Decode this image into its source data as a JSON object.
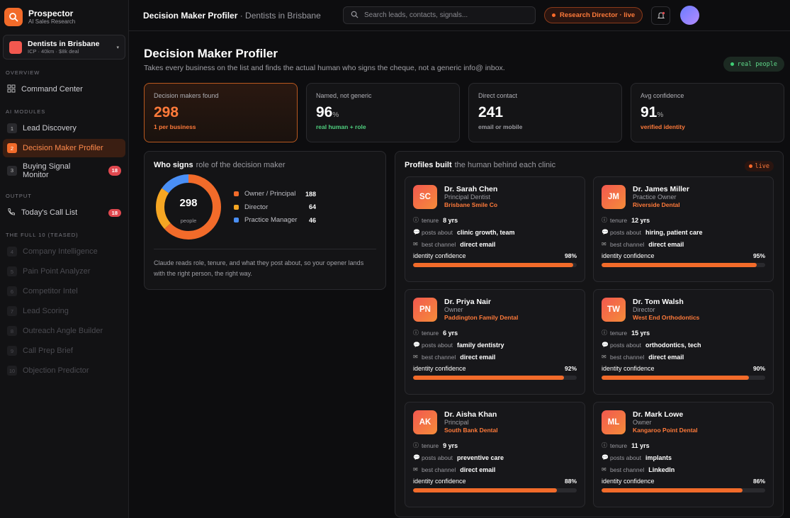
{
  "sidebar": {
    "brand": {
      "name": "Prospector",
      "sub": "AI Sales Research"
    },
    "icp": {
      "title": "Dentists in Brisbane",
      "sub": "ICP · 40km · $8k deal"
    },
    "sections": {
      "overview": "OVERVIEW",
      "modules": "AI MODULES",
      "output": "OUTPUT",
      "full10": "THE FULL 10 (TEASED)"
    },
    "command_center": "Command Center",
    "modules": [
      {
        "num": "1",
        "label": "Lead Discovery"
      },
      {
        "num": "2",
        "label": "Decision Maker Profiler"
      },
      {
        "num": "3",
        "label": "Buying Signal Monitor",
        "badge": "18"
      }
    ],
    "output": {
      "label": "Today's Call List",
      "badge": "18"
    },
    "teased": [
      {
        "num": "4",
        "label": "Company Intelligence"
      },
      {
        "num": "5",
        "label": "Pain Point Analyzer"
      },
      {
        "num": "6",
        "label": "Competitor Intel"
      },
      {
        "num": "7",
        "label": "Lead Scoring"
      },
      {
        "num": "8",
        "label": "Outreach Angle Builder"
      },
      {
        "num": "9",
        "label": "Call Prep Brief"
      },
      {
        "num": "10",
        "label": "Objection Predictor"
      }
    ]
  },
  "topbar": {
    "title": "Decision Maker Profiler",
    "context": " · Dentists in Brisbane",
    "search_placeholder": "Search leads, contacts, signals...",
    "live_pill": "Research Director · live"
  },
  "page": {
    "title": "Decision Maker Profiler",
    "subtitle": "Takes every business on the list and finds the actual human who signs the cheque, not a generic info@ inbox.",
    "tag": "real people"
  },
  "stats": [
    {
      "label": "Decision makers found",
      "value": "298",
      "unit": "",
      "foot": "1 per business",
      "foot_color": "#ff7a3a"
    },
    {
      "label": "Named, not generic",
      "value": "96",
      "unit": "%",
      "foot": "real human + role",
      "foot_color": "#4fd07f"
    },
    {
      "label": "Direct contact",
      "value": "241",
      "unit": "",
      "foot": "email or mobile",
      "foot_color": "#9a9aa0"
    },
    {
      "label": "Avg confidence",
      "value": "91",
      "unit": "%",
      "foot": "verified identity",
      "foot_color": "#ff7a3a"
    }
  ],
  "who_signs": {
    "title": "Who signs",
    "subtitle": "role of the decision maker",
    "total": "298",
    "total_label": "people",
    "segments": [
      {
        "label": "Owner / Principal",
        "value": 188,
        "color": "#f26b2a"
      },
      {
        "label": "Director",
        "value": 64,
        "color": "#f5a623"
      },
      {
        "label": "Practice Manager",
        "value": 46,
        "color": "#4a8ff5"
      }
    ],
    "note": "Claude reads role, tenure, and what they post about, so your opener lands with the right person, the right way."
  },
  "profiles": {
    "title": "Profiles built",
    "subtitle": "the human behind each clinic",
    "live": "live",
    "labels": {
      "tenure": "tenure",
      "posts": "posts about",
      "channel": "best channel",
      "confidence": "identity confidence"
    },
    "items": [
      {
        "initials": "SC",
        "name": "Dr. Sarah Chen",
        "role": "Principal Dentist",
        "org": "Brisbane Smile Co",
        "tenure": "8 yrs",
        "posts": "clinic growth, team",
        "channel": "direct email",
        "confidence": 98,
        "confidence_label": "98%"
      },
      {
        "initials": "JM",
        "name": "Dr. James Miller",
        "role": "Practice Owner",
        "org": "Riverside Dental",
        "tenure": "12 yrs",
        "posts": "hiring, patient care",
        "channel": "direct email",
        "confidence": 95,
        "confidence_label": "95%"
      },
      {
        "initials": "PN",
        "name": "Dr. Priya Nair",
        "role": "Owner",
        "org": "Paddington Family Dental",
        "tenure": "6 yrs",
        "posts": "family dentistry",
        "channel": "direct email",
        "confidence": 92,
        "confidence_label": "92%"
      },
      {
        "initials": "TW",
        "name": "Dr. Tom Walsh",
        "role": "Director",
        "org": "West End Orthodontics",
        "tenure": "15 yrs",
        "posts": "orthodontics, tech",
        "channel": "direct email",
        "confidence": 90,
        "confidence_label": "90%"
      },
      {
        "initials": "AK",
        "name": "Dr. Aisha Khan",
        "role": "Principal",
        "org": "South Bank Dental",
        "tenure": "9 yrs",
        "posts": "preventive care",
        "channel": "direct email",
        "confidence": 88,
        "confidence_label": "88%"
      },
      {
        "initials": "ML",
        "name": "Dr. Mark Lowe",
        "role": "Owner",
        "org": "Kangaroo Point Dental",
        "tenure": "11 yrs",
        "posts": "implants",
        "channel": "LinkedIn",
        "confidence": 86,
        "confidence_label": "86%"
      }
    ]
  }
}
